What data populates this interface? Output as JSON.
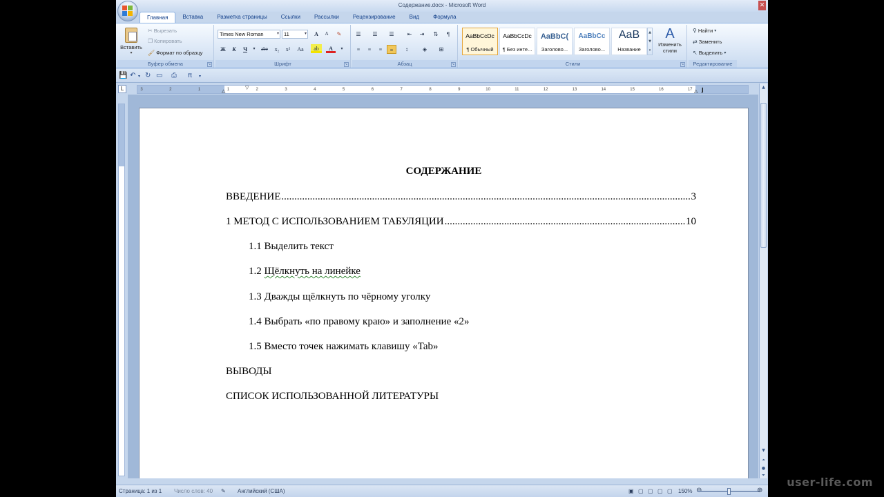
{
  "window": {
    "title": "Содержание.docx - Microsoft Word",
    "close": "✕"
  },
  "tabs": [
    "Главная",
    "Вставка",
    "Разметка страницы",
    "Ссылки",
    "Рассылки",
    "Рецензирование",
    "Вид",
    "Формула"
  ],
  "clipboard": {
    "paste": "Вставить",
    "cut": "Вырезать",
    "copy": "Копировать",
    "format_painter": "Формат по образцу",
    "label": "Буфер обмена"
  },
  "font": {
    "name": "Times New Roman",
    "size": "11",
    "label": "Шрифт",
    "bold": "Ж",
    "italic": "К",
    "underline": "Ч",
    "strike": "abe",
    "sub": "x₂",
    "sup": "x²",
    "case": "Aa",
    "grow": "A",
    "shrink": "A"
  },
  "paragraph": {
    "label": "Абзац"
  },
  "styles": {
    "label": "Стили",
    "items": [
      {
        "sample": "AaBbCcDc",
        "name": "¶ Обычный"
      },
      {
        "sample": "AaBbCcDc",
        "name": "¶ Без инте..."
      },
      {
        "sample": "AaBbC(",
        "name": "Заголово..."
      },
      {
        "sample": "AaBbCc",
        "name": "Заголово..."
      },
      {
        "sample": "AaB",
        "name": "Название"
      }
    ],
    "change": "Изменить стили"
  },
  "editing": {
    "label": "Редактирование",
    "find": "Найти",
    "replace": "Заменить",
    "select": "Выделить"
  },
  "ruler": {
    "tab_selector": "L",
    "ticks": [
      "3",
      "2",
      "1",
      "1",
      "2",
      "3",
      "4",
      "5",
      "6",
      "7",
      "8",
      "9",
      "10",
      "11",
      "12",
      "13",
      "14",
      "15",
      "16",
      "17"
    ]
  },
  "document": {
    "heading": "СОДЕРЖАНИЕ",
    "toc": [
      {
        "title": "ВВЕДЕНИЕ",
        "page": "3"
      },
      {
        "title": "1 МЕТОД С ИСПОЛЬЗОВАНИЕМ ТАБУЛЯЦИИ",
        "page": "10"
      }
    ],
    "subitems": [
      {
        "num": "1.1",
        "text": "Выделить текст"
      },
      {
        "num": "1.2",
        "text": "Щёлкнуть на линейке"
      },
      {
        "num": "1.3",
        "text": "Дважды щёлкнуть по чёрному уголку"
      },
      {
        "num": "1.4",
        "text": "Выбрать «по правому краю» и заполнение «2»"
      },
      {
        "num": "1.5",
        "text": "Вместо точек нажимать клавишу «Tab»"
      }
    ],
    "conclusions": "ВЫВОДЫ",
    "references": "СПИСОК ИСПОЛЬЗОВАННОЙ ЛИТЕРАТУРЫ"
  },
  "status": {
    "page": "Страница: 1 из 1",
    "words": "Число слов: 40",
    "language": "Английский (США)",
    "zoom": "150%"
  },
  "watermark": "user-life.com"
}
